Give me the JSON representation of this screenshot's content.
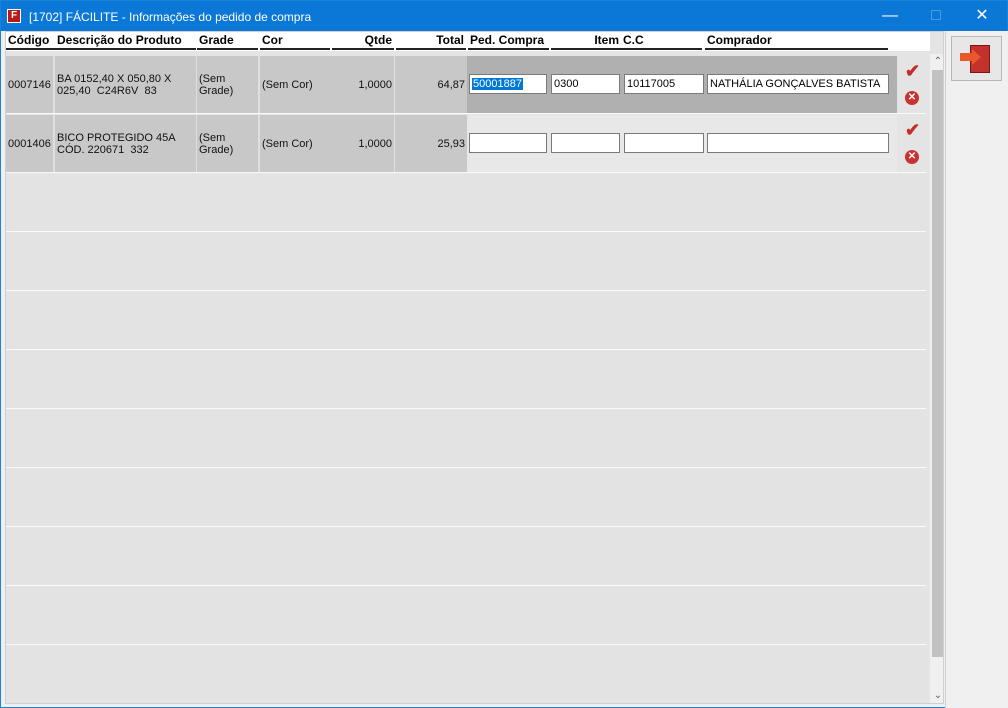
{
  "window": {
    "title": "[1702] FÁCILITE - Informações do pedido de compra",
    "minimize_icon": "—",
    "maximize_icon": "□",
    "close_icon": "✕",
    "app_icon": "F"
  },
  "table": {
    "headers": {
      "codigo": "Código",
      "descricao": "Descrição do Produto",
      "grade": "Grade",
      "cor": "Cor",
      "qtde": "Qtde",
      "total": "Total",
      "pedido": "Ped. Compra",
      "item": "Item",
      "cc": "C.C",
      "comprador": "Comprador"
    },
    "rows": [
      {
        "codigo": "0007146",
        "descricao": "BA 0152,40 X 050,80 X\n025,40  C24R6V  83",
        "grade": "(Sem Grade)",
        "cor": "(Sem Cor)",
        "qtde": "1,0000",
        "total": "64,87",
        "pedido": "50001887",
        "item": "0300",
        "cc": "10117005",
        "comprador": "NATHÁLIA GONÇALVES BATISTA"
      },
      {
        "codigo": "0001406",
        "descricao": "BICO PROTEGIDO 45A\nCÓD. 220671  332",
        "grade": "(Sem Grade)",
        "cor": "(Sem Cor)",
        "qtde": "1,0000",
        "total": "25,93",
        "pedido": "",
        "item": "",
        "cc": "",
        "comprador": ""
      }
    ]
  },
  "icons": {
    "confirm": "✔",
    "cancel": "✕",
    "scroll_up": "⌃",
    "scroll_down": "⌄"
  },
  "colors": {
    "titlebar": "#0b78d7",
    "selected": "#0078d7",
    "confirm": "#c52d2d",
    "cancel": "#c83232"
  }
}
